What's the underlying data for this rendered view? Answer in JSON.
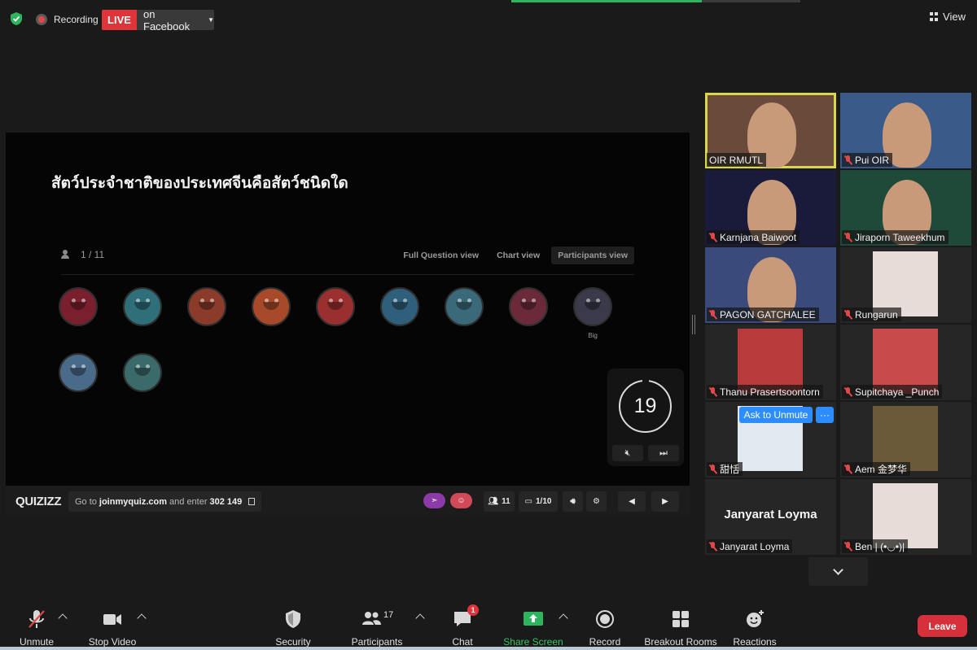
{
  "topbar": {
    "recording_label": "Recording",
    "live_label": "LIVE",
    "live_target": "on Facebook",
    "view_label": "View"
  },
  "share": {
    "question": "สัตว์ประจำชาติของประเทศจีนคือสัตว์ชนิดใด",
    "participant_count": "1 / 11",
    "tabs": [
      {
        "label": "Full Question view",
        "active": false
      },
      {
        "label": "Chart view",
        "active": false
      },
      {
        "label": "Participants view",
        "active": true
      }
    ],
    "avatar_colors": [
      "#7a1f2e",
      "#2f6f7a",
      "#8a3b2a",
      "#a84a2a",
      "#9a2f2f",
      "#2f5f7a",
      "#3a6a7a",
      "#6a2a3a",
      "#3a3a4a",
      "#4a6a8a",
      "#3a6a6a"
    ],
    "avatar_labels": [
      "",
      "",
      "",
      "",
      "",
      "",
      "",
      "",
      "Big",
      "",
      ""
    ],
    "timer_value": "19"
  },
  "quizizz": {
    "logo": "QUIZIZZ",
    "join_prefix": "Go to",
    "join_site": "joinmyquiz.com",
    "join_mid": "and enter",
    "join_code": "302 149",
    "players": "11",
    "question_progress": "1/10"
  },
  "gallery": {
    "tiles": [
      {
        "name": "OIR RMUTL",
        "muted": false,
        "active": true,
        "bg": "#6a4a3a"
      },
      {
        "name": "Pui OIR",
        "muted": true,
        "active": false,
        "bg": "#3a5a8a"
      },
      {
        "name": "Karnjana Baiwoot",
        "muted": true,
        "active": false,
        "bg": "#1a1a3a"
      },
      {
        "name": "Jiraporn Taweekhum",
        "muted": true,
        "active": false,
        "bg": "#1f4a3a"
      },
      {
        "name": "PAGON GATCHALEE",
        "muted": true,
        "active": false,
        "bg": "#3a4a7a"
      },
      {
        "name": "Rungarun",
        "muted": true,
        "active": false,
        "bg": "#262626"
      },
      {
        "name": "Thanu Prasertsoontorn",
        "muted": true,
        "active": false,
        "bg": "#262626"
      },
      {
        "name": "Supitchaya _Punch",
        "muted": true,
        "active": false,
        "bg": "#262626"
      },
      {
        "name": "甜恬",
        "muted": true,
        "active": false,
        "bg": "#262626"
      },
      {
        "name": "Aem 金梦华",
        "muted": true,
        "active": false,
        "bg": "#262626"
      },
      {
        "name": "Janyarat Loyma",
        "muted": true,
        "active": false,
        "bg": "#262626",
        "big_name": "Janyarat Loyma"
      },
      {
        "name": "Ben | (•◡•)|",
        "muted": true,
        "active": false,
        "bg": "#262626"
      }
    ],
    "ask_unmute": "Ask to Unmute",
    "more": "···"
  },
  "controls": {
    "unmute": "Unmute",
    "stop_video": "Stop Video",
    "security": "Security",
    "participants": "Participants",
    "participants_count": "17",
    "chat": "Chat",
    "chat_badge": "1",
    "share_screen": "Share Screen",
    "record": "Record",
    "breakout_rooms": "Breakout Rooms",
    "reactions": "Reactions",
    "leave": "Leave"
  },
  "colors": {
    "accent_blue": "#2d8cff",
    "live_red": "#e0343b",
    "share_green": "#3ac267",
    "active_speaker": "#d8d84a"
  },
  "top_progress_fraction": 0.66
}
